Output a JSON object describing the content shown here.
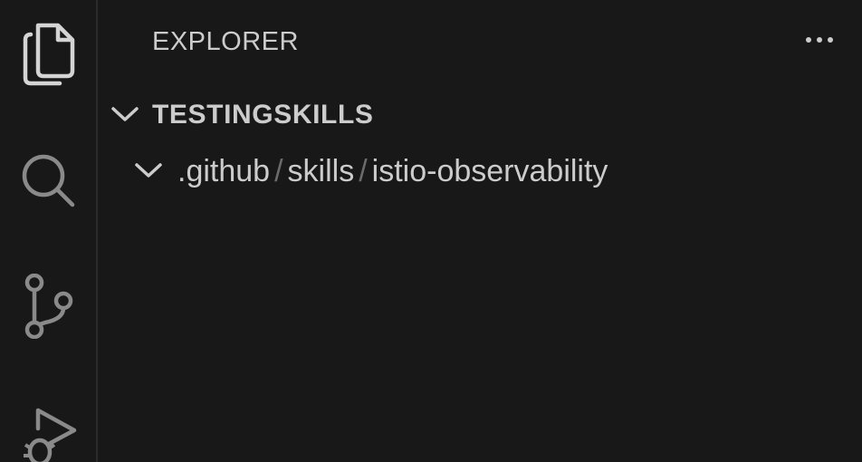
{
  "activity_bar": {
    "items": [
      {
        "icon": "files-icon",
        "active": true
      },
      {
        "icon": "search-icon",
        "active": false
      },
      {
        "icon": "source-control-icon",
        "active": false
      },
      {
        "icon": "run-debug-icon",
        "active": false
      }
    ]
  },
  "sidebar": {
    "title": "EXPLORER",
    "more_actions_icon": "ellipsis-icon",
    "folder": {
      "name": "TESTINGSKILLS",
      "expanded": true
    },
    "tree": {
      "expanded": true,
      "path_segments": [
        ".github",
        "skills",
        "istio-observability"
      ],
      "separator": "/"
    }
  },
  "colors": {
    "background": "#181818",
    "text": "#cccccc",
    "icon_active": "#d4d4d4",
    "icon_inactive": "#8a8a8a",
    "separator": "#6b6b6b"
  }
}
